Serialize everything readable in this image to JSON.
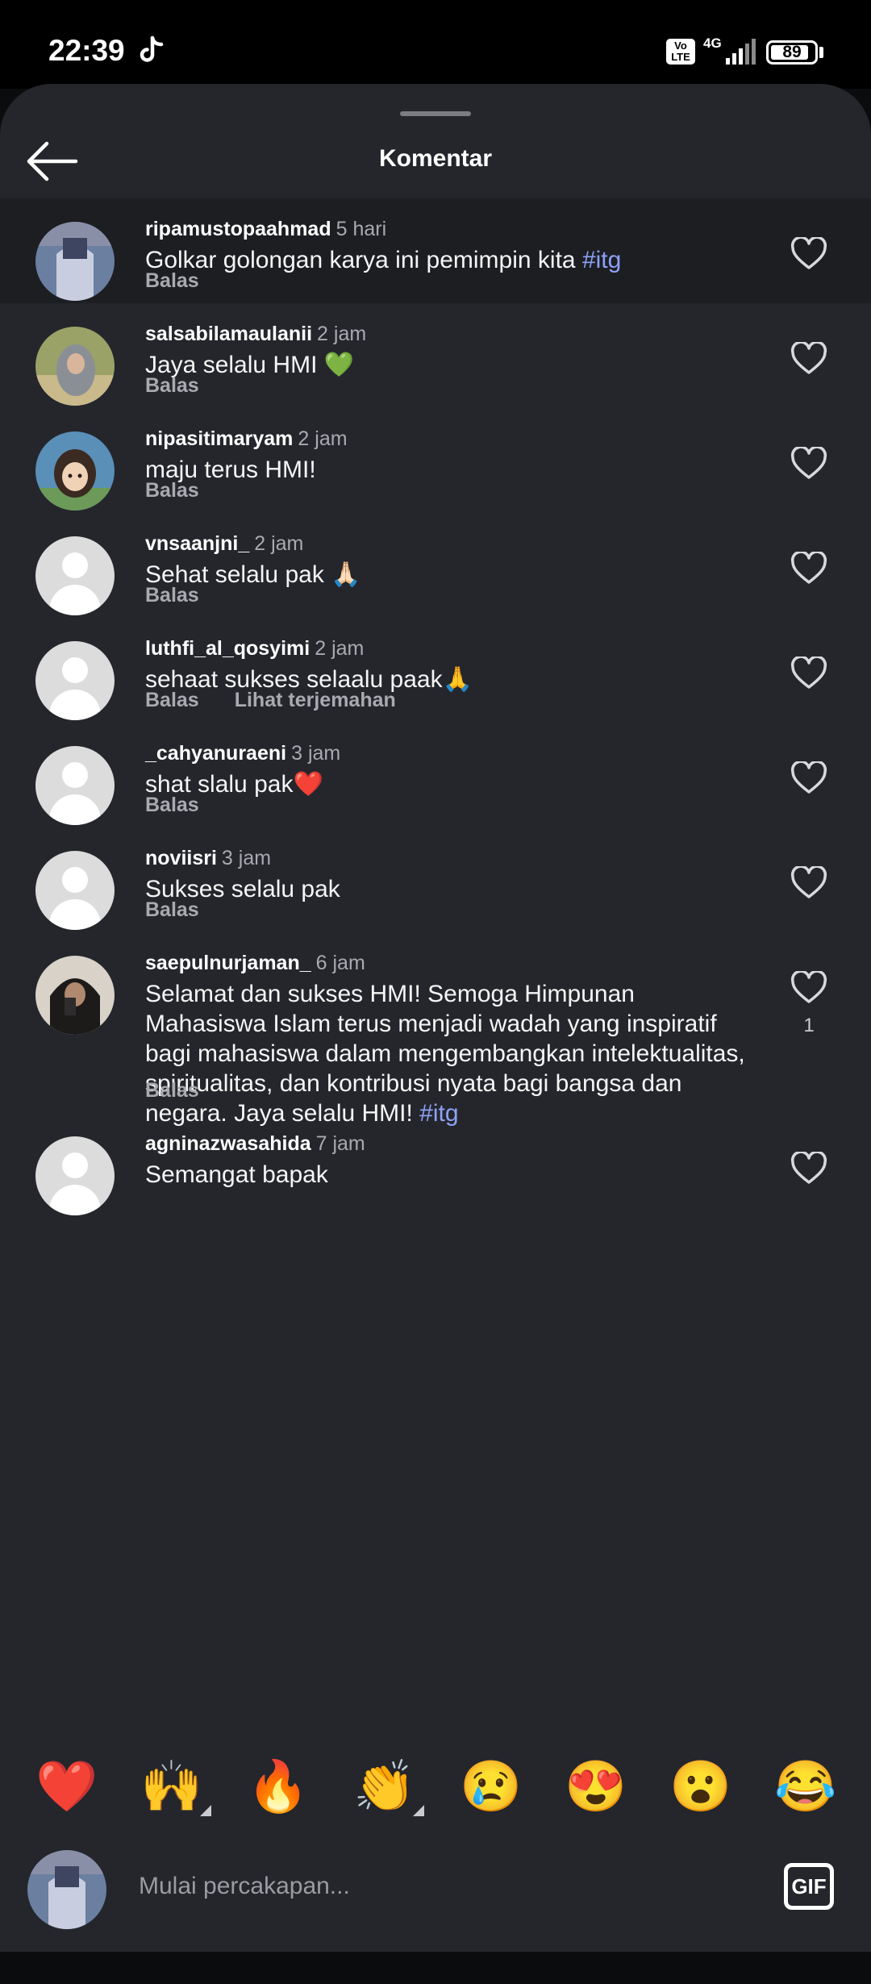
{
  "status": {
    "time": "22:39",
    "volte": "Vo LTE",
    "network": "4G",
    "battery": "89"
  },
  "header": {
    "title": "Komentar"
  },
  "comments": [
    {
      "user": "ripamustopaahmad",
      "time": "5 hari",
      "text": "Golkar golongan karya ini pemimpin kita ",
      "hashtag": "#itg",
      "reply": "Balas"
    },
    {
      "user": "salsabilamaulanii",
      "time": "2 jam",
      "text": "Jaya selalu HMI 💚",
      "reply": "Balas"
    },
    {
      "user": "nipasitimaryam",
      "time": "2 jam",
      "text": "maju terus HMI!",
      "reply": "Balas"
    },
    {
      "user": "vnsaanjni_",
      "time": "2 jam",
      "text": "Sehat selalu pak 🙏🏻",
      "reply": "Balas"
    },
    {
      "user": "luthfi_al_qosyimi",
      "time": "2 jam",
      "text": "sehaat sukses selaalu paak🙏",
      "reply": "Balas",
      "translate": "Lihat terjemahan"
    },
    {
      "user": "_cahyanuraeni",
      "time": "3 jam",
      "text": "shat slalu pak❤️",
      "reply": "Balas"
    },
    {
      "user": "noviisri",
      "time": "3 jam",
      "text": "Sukses selalu pak",
      "reply": "Balas"
    },
    {
      "user": "saepulnurjaman_",
      "time": "6 jam",
      "text": "Selamat dan sukses HMI! Semoga Himpunan Mahasiswa Islam terus menjadi wadah yang inspiratif bagi mahasiswa dalam mengembangkan intelektualitas, spiritualitas, dan kontribusi nyata bagi bangsa dan negara. Jaya selalu HMI! ",
      "hashtag": "#itg",
      "reply": "Balas",
      "likes": "1"
    },
    {
      "user": "agninazwasahida",
      "time": "7 jam",
      "text": "Semangat bapak"
    }
  ],
  "emoji_bar": [
    "❤️",
    "🙌",
    "🔥",
    "👏",
    "😢",
    "😍",
    "😮",
    "😂"
  ],
  "composer": {
    "placeholder": "Mulai percakapan...",
    "gif_label": "GIF"
  }
}
